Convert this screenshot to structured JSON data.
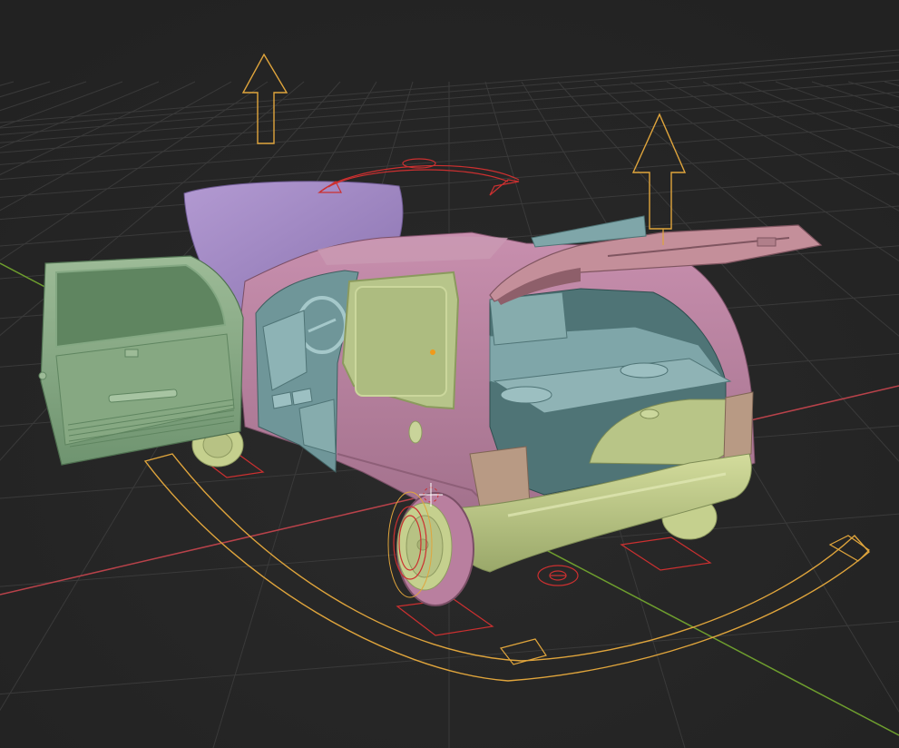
{
  "viewport": {
    "background": "#262626",
    "grid_color": "#3a3a3a",
    "x_axis_color": "#b8424a",
    "y_axis_color": "#6e9e2e"
  },
  "materials": {
    "body_pink": "#b97f9f",
    "body_pink_dark": "#8e5f78",
    "door_green": "#8fb08a",
    "door_green_dark": "#5f8560",
    "glass_yellow": "#b7c58a",
    "interior_teal": "#7fa6a9",
    "interior_teal_dark": "#4f7476",
    "hood_purple": "#a58cc8",
    "bumper_yellow": "#c4cf8c",
    "taillight_tan": "#b89a84",
    "hatch_rose": "#c48f9a"
  },
  "rig": {
    "control_orange": "#e0a53c",
    "control_red": "#cc3030",
    "origin_orange": "#f09a1a"
  }
}
